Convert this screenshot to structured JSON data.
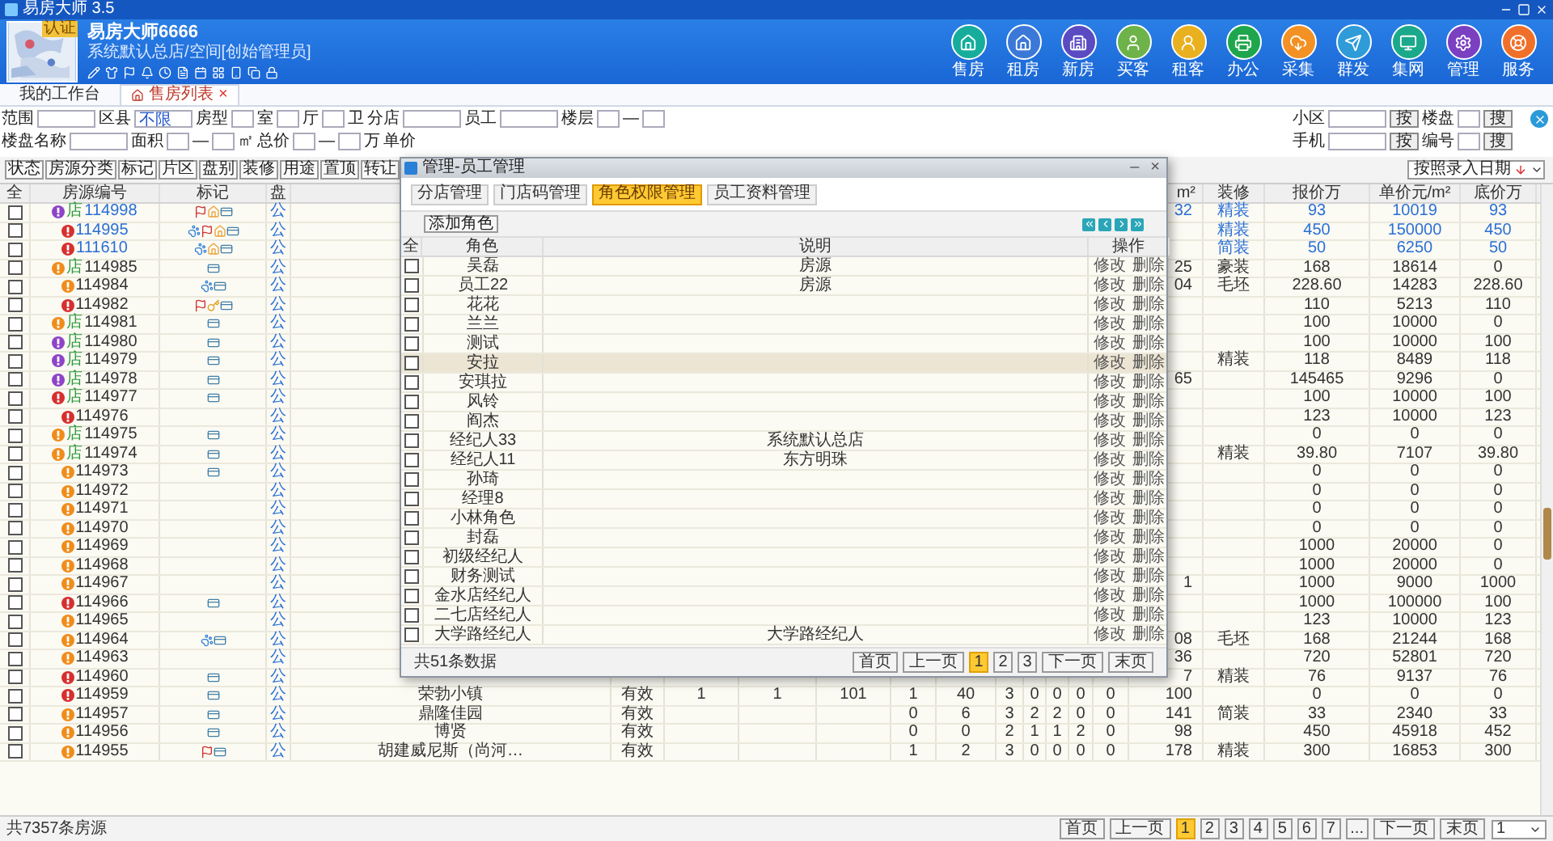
{
  "window": {
    "title": "易房大师 3.5"
  },
  "header": {
    "avatar_tag": "认证",
    "user_name": "易房大师6666",
    "user_role": "系统默认总店/空间[创始管理员]",
    "nav": [
      {
        "label": "售房",
        "color": "#16ad9c"
      },
      {
        "label": "租房",
        "color": "#3b78d8"
      },
      {
        "label": "新房",
        "color": "#5a4bc2"
      },
      {
        "label": "买客",
        "color": "#6db34a"
      },
      {
        "label": "租客",
        "color": "#e9b020"
      },
      {
        "label": "办公",
        "color": "#1fa64c"
      },
      {
        "label": "采集",
        "color": "#f39125"
      },
      {
        "label": "群发",
        "color": "#2f9bd8"
      },
      {
        "label": "集网",
        "color": "#1ba98b"
      },
      {
        "label": "管理",
        "color": "#7b3fc2"
      },
      {
        "label": "服务",
        "color": "#f0702a"
      }
    ]
  },
  "tabs": [
    {
      "label": "我的工作台",
      "selected": false
    },
    {
      "label": "售房列表",
      "selected": true,
      "close": "×"
    }
  ],
  "filters": {
    "left_rows": [
      [
        {
          "kind": "label",
          "text": "范围"
        },
        {
          "kind": "field"
        },
        {
          "kind": "label",
          "text": "区县"
        },
        {
          "kind": "field",
          "value": "不限"
        },
        {
          "kind": "label",
          "text": "房型"
        },
        {
          "kind": "small_field"
        },
        {
          "kind": "label",
          "text": "室"
        },
        {
          "kind": "small_field"
        },
        {
          "kind": "label",
          "text": "厅"
        },
        {
          "kind": "small_field"
        },
        {
          "kind": "label",
          "text": "卫"
        },
        {
          "kind": "label",
          "text": "分店"
        },
        {
          "kind": "field"
        },
        {
          "kind": "label",
          "text": "员工"
        },
        {
          "kind": "field"
        },
        {
          "kind": "label",
          "text": "楼层"
        },
        {
          "kind": "small_field"
        },
        {
          "kind": "label",
          "text": "—"
        },
        {
          "kind": "small_field"
        }
      ],
      [
        {
          "kind": "label",
          "text": "楼盘名称"
        },
        {
          "kind": "field"
        },
        {
          "kind": "label",
          "text": "面积"
        },
        {
          "kind": "small_field"
        },
        {
          "kind": "label",
          "text": "—"
        },
        {
          "kind": "small_field"
        },
        {
          "kind": "label",
          "text": "㎡"
        },
        {
          "kind": "label",
          "text": "总价"
        },
        {
          "kind": "small_field"
        },
        {
          "kind": "label",
          "text": "—"
        },
        {
          "kind": "small_field"
        },
        {
          "kind": "label",
          "text": "万"
        },
        {
          "kind": "label",
          "text": "单价"
        }
      ]
    ],
    "right_rows": [
      [
        {
          "kind": "label",
          "text": "小区"
        },
        {
          "kind": "field"
        },
        {
          "kind": "button",
          "text": "按"
        },
        {
          "kind": "label",
          "text": "楼盘"
        },
        {
          "kind": "small_field"
        },
        {
          "kind": "button",
          "text": "搜"
        }
      ],
      [
        {
          "kind": "label",
          "text": "手机"
        },
        {
          "kind": "field"
        },
        {
          "kind": "button",
          "text": "按"
        },
        {
          "kind": "label",
          "text": "编号"
        },
        {
          "kind": "small_field"
        },
        {
          "kind": "button",
          "text": "搜"
        }
      ]
    ]
  },
  "toolbar": [
    "状态",
    "房源分类",
    "标记",
    "片区",
    "盘别",
    "装修",
    "用途",
    "置顶",
    "转让"
  ],
  "sort": {
    "label": "按照录入日期"
  },
  "table": {
    "columns_left": [
      "全",
      "房源编号",
      "标记",
      "盘"
    ],
    "columns_right": [
      "m²",
      "装修",
      "报价万",
      "单价元/m²",
      "底价万"
    ],
    "rows": [
      {
        "checked": false,
        "color": "#8e44c8",
        "store_tag": "店",
        "id": "114998",
        "highlighted": true,
        "marks": [
          {
            "kind": "flag"
          },
          {
            "kind": "house"
          },
          {
            "kind": "card"
          }
        ],
        "pan": "公",
        "area": "32",
        "decor": "精装",
        "price": "93",
        "unit_price": "10019",
        "floor_price": "93"
      },
      {
        "checked": false,
        "color": "#d62f2f",
        "id": "114995",
        "highlighted": true,
        "marks": [
          {
            "kind": "paw"
          },
          {
            "kind": "flag"
          },
          {
            "kind": "house"
          },
          {
            "kind": "card"
          }
        ],
        "pan": "公",
        "decor": "精装",
        "price": "450",
        "unit_price": "150000",
        "floor_price": "450"
      },
      {
        "checked": false,
        "color": "#d62f2f",
        "id": "111610",
        "highlighted": true,
        "marks": [
          {
            "kind": "paw"
          },
          {
            "kind": "house"
          },
          {
            "kind": "card"
          }
        ],
        "pan": "公",
        "decor": "简装",
        "price": "50",
        "unit_price": "6250",
        "floor_price": "50"
      },
      {
        "checked": false,
        "color": "#f08c1a",
        "store_tag": "店",
        "id": "114985",
        "highlighted": false,
        "marks": [
          {
            "kind": "card"
          }
        ],
        "pan": "公",
        "area": "25",
        "decor": "豪装",
        "price": "168",
        "unit_price": "18614",
        "floor_price": "0"
      },
      {
        "checked": false,
        "color": "#f08c1a",
        "id": "114984",
        "highlighted": false,
        "marks": [
          {
            "kind": "paw"
          },
          {
            "kind": "card"
          }
        ],
        "pan": "公",
        "area": "04",
        "decor": "毛坯",
        "price": "228.60",
        "unit_price": "14283",
        "floor_price": "228.60"
      },
      {
        "checked": false,
        "color": "#d62f2f",
        "id": "114982",
        "highlighted": false,
        "marks": [
          {
            "kind": "flag"
          },
          {
            "kind": "key"
          },
          {
            "kind": "card"
          }
        ],
        "pan": "公",
        "price": "110",
        "unit_price": "5213",
        "floor_price": "110"
      },
      {
        "checked": false,
        "color": "#f08c1a",
        "store_tag": "店",
        "id": "114981",
        "highlighted": false,
        "marks": [
          {
            "kind": "card"
          }
        ],
        "pan": "公",
        "price": "100",
        "unit_price": "10000",
        "floor_price": "0"
      },
      {
        "checked": false,
        "color": "#8e44c8",
        "store_tag": "店",
        "id": "114980",
        "highlighted": false,
        "marks": [
          {
            "kind": "card"
          }
        ],
        "pan": "公",
        "price": "100",
        "unit_price": "10000",
        "floor_price": "100"
      },
      {
        "checked": false,
        "color": "#8e44c8",
        "store_tag": "店",
        "id": "114979",
        "highlighted": false,
        "marks": [
          {
            "kind": "card"
          }
        ],
        "pan": "公",
        "decor": "精装",
        "price": "118",
        "unit_price": "8489",
        "floor_price": "118"
      },
      {
        "checked": false,
        "color": "#8e44c8",
        "store_tag": "店",
        "id": "114978",
        "highlighted": false,
        "marks": [
          {
            "kind": "card"
          }
        ],
        "pan": "公",
        "area": "65",
        "price": "145465",
        "unit_price": "9296",
        "floor_price": "0"
      },
      {
        "checked": false,
        "color": "#d62f2f",
        "store_tag": "店",
        "id": "114977",
        "highlighted": false,
        "marks": [
          {
            "kind": "card"
          }
        ],
        "pan": "公",
        "price": "100",
        "unit_price": "10000",
        "floor_price": "100"
      },
      {
        "checked": false,
        "color": "#d62f2f",
        "id": "114976",
        "highlighted": false,
        "pan": "公",
        "price": "123",
        "unit_price": "10000",
        "floor_price": "123"
      },
      {
        "checked": false,
        "color": "#f08c1a",
        "store_tag": "店",
        "id": "114975",
        "highlighted": false,
        "marks": [
          {
            "kind": "card"
          }
        ],
        "pan": "公",
        "price": "0",
        "unit_price": "0",
        "floor_price": "0"
      },
      {
        "checked": false,
        "color": "#f08c1a",
        "store_tag": "店",
        "id": "114974",
        "highlighted": false,
        "marks": [
          {
            "kind": "card"
          }
        ],
        "pan": "公",
        "decor": "精装",
        "price": "39.80",
        "unit_price": "7107",
        "floor_price": "39.80"
      },
      {
        "checked": false,
        "color": "#f08c1a",
        "id": "114973",
        "highlighted": false,
        "marks": [
          {
            "kind": "card"
          }
        ],
        "pan": "公",
        "price": "0",
        "unit_price": "0",
        "floor_price": "0"
      },
      {
        "checked": false,
        "color": "#f08c1a",
        "id": "114972",
        "highlighted": false,
        "pan": "公",
        "price": "0",
        "unit_price": "0",
        "floor_price": "0"
      },
      {
        "checked": false,
        "color": "#f08c1a",
        "id": "114971",
        "highlighted": false,
        "pan": "公",
        "price": "0",
        "unit_price": "0",
        "floor_price": "0"
      },
      {
        "checked": false,
        "color": "#f08c1a",
        "id": "114970",
        "highlighted": false,
        "pan": "公",
        "price": "0",
        "unit_price": "0",
        "floor_price": "0"
      },
      {
        "checked": false,
        "color": "#f08c1a",
        "id": "114969",
        "highlighted": false,
        "pan": "公",
        "price": "1000",
        "unit_price": "20000",
        "floor_price": "0"
      },
      {
        "checked": false,
        "color": "#f08c1a",
        "id": "114968",
        "highlighted": false,
        "pan": "公",
        "price": "1000",
        "unit_price": "20000",
        "floor_price": "0"
      },
      {
        "checked": false,
        "color": "#f08c1a",
        "id": "114967",
        "highlighted": false,
        "pan": "公",
        "area": "1",
        "price": "1000",
        "unit_price": "9000",
        "floor_price": "1000"
      },
      {
        "checked": false,
        "color": "#d62f2f",
        "id": "114966",
        "highlighted": false,
        "marks": [
          {
            "kind": "card"
          }
        ],
        "pan": "公",
        "price": "1000",
        "unit_price": "100000",
        "floor_price": "100"
      },
      {
        "checked": false,
        "color": "#f08c1a",
        "id": "114965",
        "highlighted": false,
        "pan": "公",
        "price": "123",
        "unit_price": "10000",
        "floor_price": "123"
      },
      {
        "checked": false,
        "color": "#f08c1a",
        "id": "114964",
        "highlighted": false,
        "marks": [
          {
            "kind": "paw"
          },
          {
            "kind": "card"
          }
        ],
        "pan": "公",
        "area": "08",
        "decor": "毛坯",
        "price": "168",
        "unit_price": "21244",
        "floor_price": "168"
      },
      {
        "checked": false,
        "color": "#f08c1a",
        "id": "114963",
        "highlighted": false,
        "pan": "公",
        "area": "36",
        "price": "720",
        "unit_price": "52801",
        "floor_price": "720"
      },
      {
        "checked": false,
        "color": "#d62f2f",
        "id": "114960",
        "highlighted": false,
        "marks": [
          {
            "kind": "card"
          }
        ],
        "pan": "公",
        "area": "7",
        "decor": "精装",
        "price": "76",
        "unit_price": "9137",
        "floor_price": "76"
      },
      {
        "checked": false,
        "color": "#d62f2f",
        "id": "114959",
        "highlighted": false,
        "marks": [
          {
            "kind": "card"
          }
        ],
        "pan": "公",
        "cells": [
          "荣勃小镇",
          "有效",
          "1",
          "1",
          "101",
          "1",
          "40",
          "3",
          "0",
          "0",
          "0",
          "0"
        ],
        "area": "100",
        "price": "0",
        "unit_price": "0",
        "floor_price": "0"
      },
      {
        "checked": false,
        "color": "#f08c1a",
        "id": "114957",
        "highlighted": false,
        "marks": [
          {
            "kind": "card"
          }
        ],
        "pan": "公",
        "cells": [
          "鼎隆佳园",
          "有效",
          null,
          null,
          null,
          "0",
          "6",
          "3",
          "2",
          "2",
          "0",
          "0"
        ],
        "area": "141",
        "decor": "简装",
        "price": "33",
        "unit_price": "2340",
        "floor_price": "33"
      },
      {
        "checked": false,
        "color": "#f08c1a",
        "id": "114956",
        "highlighted": false,
        "marks": [
          {
            "kind": "card"
          }
        ],
        "pan": "公",
        "cells": [
          "博贤",
          "有效",
          null,
          null,
          null,
          "0",
          "0",
          "2",
          "1",
          "1",
          "2",
          "0"
        ],
        "area": "98",
        "price": "450",
        "unit_price": "45918",
        "floor_price": "452"
      },
      {
        "checked": false,
        "color": "#f08c1a",
        "id": "114955",
        "highlighted": false,
        "marks": [
          {
            "kind": "flag"
          },
          {
            "kind": "card"
          }
        ],
        "pan": "公",
        "cells": [
          "胡建威尼斯（尚河…",
          "有效",
          null,
          null,
          null,
          "1",
          "2",
          "3",
          "0",
          "0",
          "0",
          "0"
        ],
        "area": "178",
        "decor": "精装",
        "price": "300",
        "unit_price": "16853",
        "floor_price": "300"
      }
    ]
  },
  "footer": {
    "total": "共7357条房源",
    "pager": {
      "first": "首页",
      "prev": "上一页",
      "pages": [
        {
          "label": "1",
          "selected": true
        },
        {
          "label": "2",
          "selected": false
        },
        {
          "label": "3",
          "selected": false
        },
        {
          "label": "4",
          "selected": false
        },
        {
          "label": "5",
          "selected": false
        },
        {
          "label": "6",
          "selected": false
        },
        {
          "label": "7",
          "selected": false
        },
        {
          "label": "...",
          "selected": false
        }
      ],
      "next": "下一页",
      "last": "末页"
    },
    "page_select": "1"
  },
  "dialog": {
    "title": "管理-员工管理",
    "minimize": "–",
    "close": "×",
    "tabs": [
      {
        "label": "分店管理",
        "selected": false
      },
      {
        "label": "门店码管理",
        "selected": false
      },
      {
        "label": "角色权限管理",
        "selected": true
      },
      {
        "label": "员工资料管理",
        "selected": false
      }
    ],
    "add_button": "添加角色",
    "columns": [
      "全",
      "角色",
      "说明",
      "操作"
    ],
    "rows": [
      {
        "checked": false,
        "selected": false,
        "role": "吴磊",
        "description": "房源",
        "edit": "修改",
        "delete": "删除"
      },
      {
        "checked": false,
        "selected": false,
        "role": "员工22",
        "description": "房源",
        "edit": "修改",
        "delete": "删除"
      },
      {
        "checked": false,
        "selected": false,
        "role": "花花",
        "edit": "修改",
        "delete": "删除"
      },
      {
        "checked": false,
        "selected": false,
        "role": "兰兰",
        "edit": "修改",
        "delete": "删除"
      },
      {
        "checked": false,
        "selected": false,
        "role": "测试",
        "edit": "修改",
        "delete": "删除"
      },
      {
        "checked": false,
        "selected": true,
        "role": "安拉",
        "edit": "修改",
        "delete": "删除"
      },
      {
        "checked": false,
        "selected": false,
        "role": "安琪拉",
        "edit": "修改",
        "delete": "删除"
      },
      {
        "checked": false,
        "selected": false,
        "role": "风铃",
        "edit": "修改",
        "delete": "删除"
      },
      {
        "checked": false,
        "selected": false,
        "role": "阎杰",
        "edit": "修改",
        "delete": "删除"
      },
      {
        "checked": false,
        "selected": false,
        "role": "经纪人33",
        "description": "系统默认总店",
        "edit": "修改",
        "delete": "删除"
      },
      {
        "checked": false,
        "selected": false,
        "role": "经纪人11",
        "description": "东方明珠",
        "edit": "修改",
        "delete": "删除"
      },
      {
        "checked": false,
        "selected": false,
        "role": "孙琦",
        "edit": "修改",
        "delete": "删除"
      },
      {
        "checked": false,
        "selected": false,
        "role": "经理8",
        "edit": "修改",
        "delete": "删除"
      },
      {
        "checked": false,
        "selected": false,
        "role": "小林角色",
        "edit": "修改",
        "delete": "删除"
      },
      {
        "checked": false,
        "selected": false,
        "role": "封磊",
        "edit": "修改",
        "delete": "删除"
      },
      {
        "checked": false,
        "selected": false,
        "role": "初级经纪人",
        "edit": "修改",
        "delete": "删除"
      },
      {
        "checked": false,
        "selected": false,
        "role": "财务测试",
        "edit": "修改",
        "delete": "删除"
      },
      {
        "checked": false,
        "selected": false,
        "role": "金水店经纪人",
        "edit": "修改",
        "delete": "删除"
      },
      {
        "checked": false,
        "selected": false,
        "role": "二七店经纪人",
        "edit": "修改",
        "delete": "删除"
      },
      {
        "checked": false,
        "selected": false,
        "role": "大学路经纪人",
        "description": "大学路经纪人",
        "edit": "修改",
        "delete": "删除"
      }
    ],
    "total": "共51条数据",
    "pager": {
      "first": "首页",
      "prev": "上一页",
      "pages": [
        {
          "label": "1",
          "selected": true
        },
        {
          "label": "2",
          "selected": false
        },
        {
          "label": "3",
          "selected": false
        }
      ],
      "next": "下一页",
      "last": "末页"
    }
  }
}
